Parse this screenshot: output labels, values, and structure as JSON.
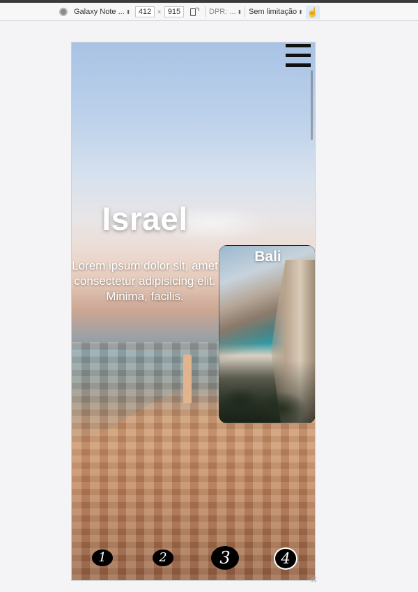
{
  "devtools": {
    "device_select": "Galaxy Note ...",
    "width": "412",
    "times": "×",
    "height": "915",
    "dpr_select": "DPR: ...",
    "throttle_select": "Sem limitação",
    "arrow": "⬍",
    "touch_icon": "☝"
  },
  "page": {
    "hero": {
      "title": "Israel",
      "description": "Lorem ipsum dolor sit, amet consectetur adipisicing elit. Minima, facilis."
    },
    "card": {
      "title": "Bali"
    },
    "pagination": [
      "1",
      "2",
      "3",
      "4"
    ]
  },
  "icons": {
    "menu": "hamburger-icon",
    "device": "chrome-icon",
    "rotate": "rotate-icon",
    "touch": "touch-icon"
  }
}
